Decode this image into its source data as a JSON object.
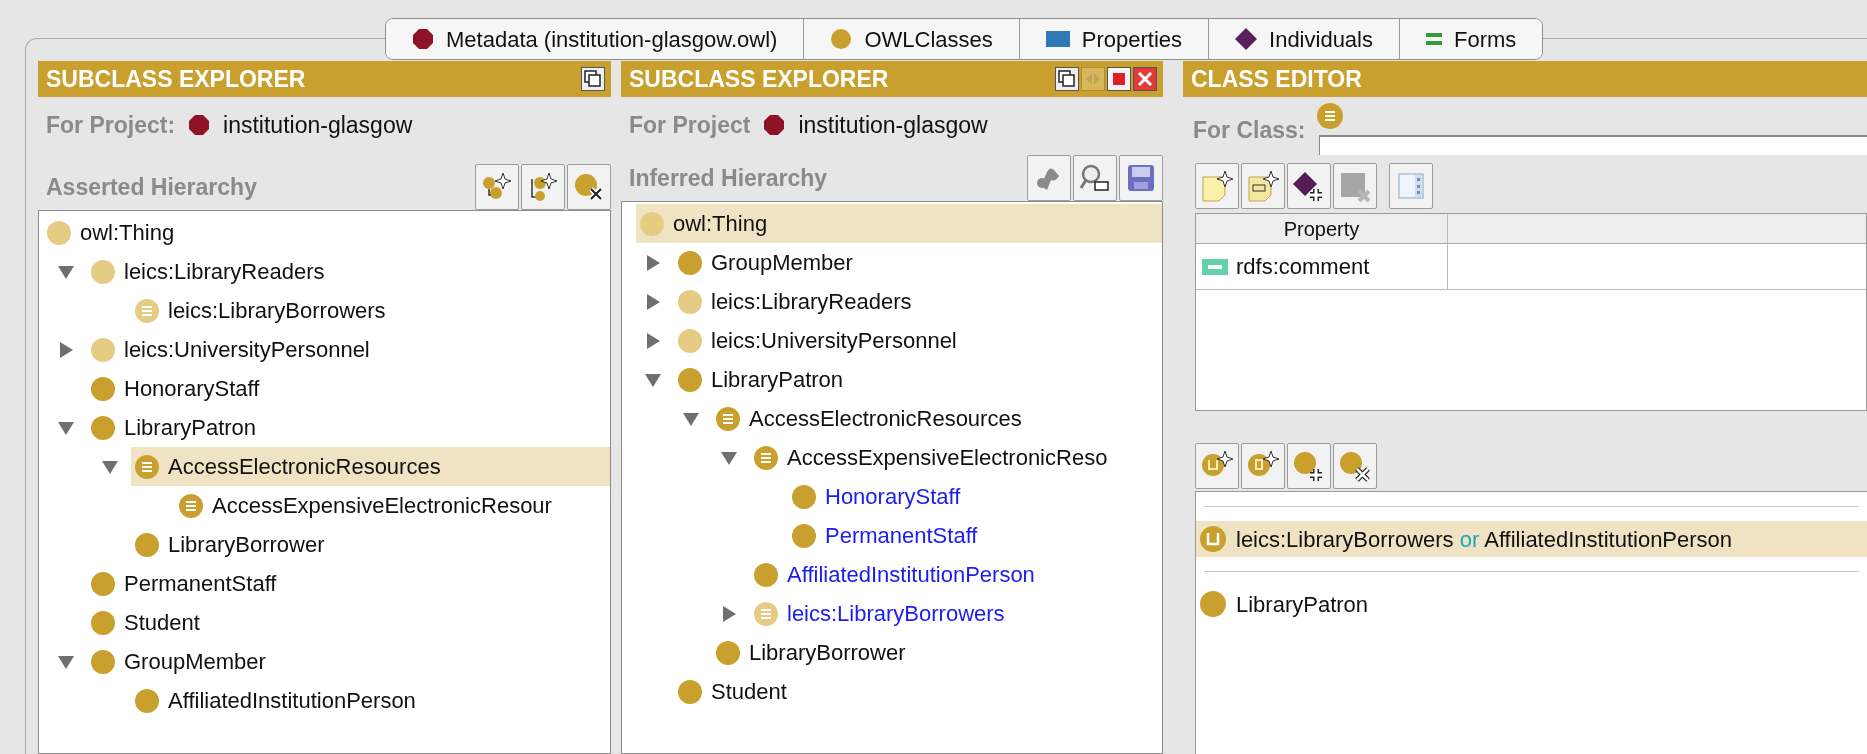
{
  "tabs": [
    {
      "label": "Metadata (institution-glasgow.owl)",
      "kind": "metadata"
    },
    {
      "label": "OWLClasses",
      "kind": "classes"
    },
    {
      "label": "Properties",
      "kind": "properties"
    },
    {
      "label": "Individuals",
      "kind": "individuals"
    },
    {
      "label": "Forms",
      "kind": "forms"
    }
  ],
  "panels": {
    "asserted": {
      "title": "SUBCLASS EXPLORER",
      "project_label": "For Project:",
      "project": "institution-glasgow",
      "hierarchy_title": "Asserted Hierarchy",
      "tree": [
        {
          "label": "owl:Thing",
          "kind": "class",
          "imported": true,
          "selected": false,
          "children": [
            {
              "label": "leics:LibraryReaders",
              "kind": "class",
              "imported": true,
              "expanded": true,
              "selected": false,
              "children": [
                {
                  "label": "leics:LibraryBorrowers",
                  "kind": "defined",
                  "imported": true,
                  "selected": false
                }
              ]
            },
            {
              "label": "leics:UniversityPersonnel",
              "kind": "class",
              "imported": true,
              "expanded": false,
              "selected": false
            },
            {
              "label": "HonoraryStaff",
              "kind": "class",
              "imported": false,
              "selected": false
            },
            {
              "label": "LibraryPatron",
              "kind": "class",
              "imported": false,
              "expanded": true,
              "selected": false,
              "children": [
                {
                  "label": "AccessElectronicResources",
                  "kind": "defined",
                  "imported": false,
                  "expanded": true,
                  "selected": true,
                  "children": [
                    {
                      "label": "AccessExpensiveElectronicResour",
                      "kind": "defined",
                      "imported": false,
                      "selected": false
                    }
                  ]
                },
                {
                  "label": "LibraryBorrower",
                  "kind": "class",
                  "imported": false,
                  "selected": false
                }
              ]
            },
            {
              "label": "PermanentStaff",
              "kind": "class",
              "imported": false,
              "selected": false
            },
            {
              "label": "Student",
              "kind": "class",
              "imported": false,
              "selected": false
            },
            {
              "label": "GroupMember",
              "kind": "class",
              "imported": false,
              "expanded": true,
              "selected": false,
              "children": [
                {
                  "label": "AffiliatedInstitutionPerson",
                  "kind": "class",
                  "imported": false,
                  "selected": false
                }
              ]
            }
          ]
        }
      ]
    },
    "inferred": {
      "title": "SUBCLASS EXPLORER",
      "project_label": "For Project",
      "project": "institution-glasgow",
      "hierarchy_title": "Inferred Hierarchy",
      "tree": [
        {
          "label": "owl:Thing",
          "kind": "class",
          "imported": true,
          "selected": true,
          "moved": false,
          "children": [
            {
              "label": "GroupMember",
              "kind": "class",
              "imported": false,
              "expanded": false,
              "selected": false,
              "moved": false
            },
            {
              "label": "leics:LibraryReaders",
              "kind": "class",
              "imported": true,
              "expanded": false,
              "selected": false,
              "moved": false
            },
            {
              "label": "leics:UniversityPersonnel",
              "kind": "class",
              "imported": true,
              "expanded": false,
              "selected": false,
              "moved": false
            },
            {
              "label": "LibraryPatron",
              "kind": "class",
              "imported": false,
              "expanded": true,
              "selected": false,
              "moved": false,
              "children": [
                {
                  "label": "AccessElectronicResources",
                  "kind": "defined",
                  "imported": false,
                  "expanded": true,
                  "selected": false,
                  "moved": false,
                  "children": [
                    {
                      "label": "AccessExpensiveElectronicReso",
                      "kind": "defined",
                      "imported": false,
                      "expanded": true,
                      "selected": false,
                      "moved": false,
                      "children": [
                        {
                          "label": "HonoraryStaff",
                          "kind": "class",
                          "imported": false,
                          "selected": false,
                          "moved": true
                        },
                        {
                          "label": "PermanentStaff",
                          "kind": "class",
                          "imported": false,
                          "selected": false,
                          "moved": true
                        }
                      ]
                    },
                    {
                      "label": "AffiliatedInstitutionPerson",
                      "kind": "class",
                      "imported": false,
                      "selected": false,
                      "moved": true
                    },
                    {
                      "label": "leics:LibraryBorrowers",
                      "kind": "defined",
                      "imported": true,
                      "expanded": false,
                      "selected": false,
                      "moved": true
                    }
                  ]
                },
                {
                  "label": "LibraryBorrower",
                  "kind": "class",
                  "imported": false,
                  "selected": false,
                  "moved": false
                }
              ]
            },
            {
              "label": "Student",
              "kind": "class",
              "imported": false,
              "selected": false,
              "moved": false
            }
          ]
        }
      ]
    }
  },
  "class_editor": {
    "title": "CLASS EDITOR",
    "for_class_label": "For Class:",
    "property_table": {
      "columns": [
        "Property"
      ],
      "rows": [
        {
          "property": "rdfs:comment"
        }
      ]
    },
    "expressions": [
      {
        "kind": "union",
        "selected": true,
        "parts": [
          {
            "text": "leics:LibraryBorrowers",
            "kind": "class"
          },
          {
            "text": "or",
            "kind": "keyword"
          },
          {
            "text": "AffiliatedInstitutionPerson",
            "kind": "class"
          }
        ]
      },
      {
        "kind": "class",
        "selected": false,
        "parts": [
          {
            "text": "LibraryPatron",
            "kind": "class"
          }
        ]
      }
    ]
  }
}
